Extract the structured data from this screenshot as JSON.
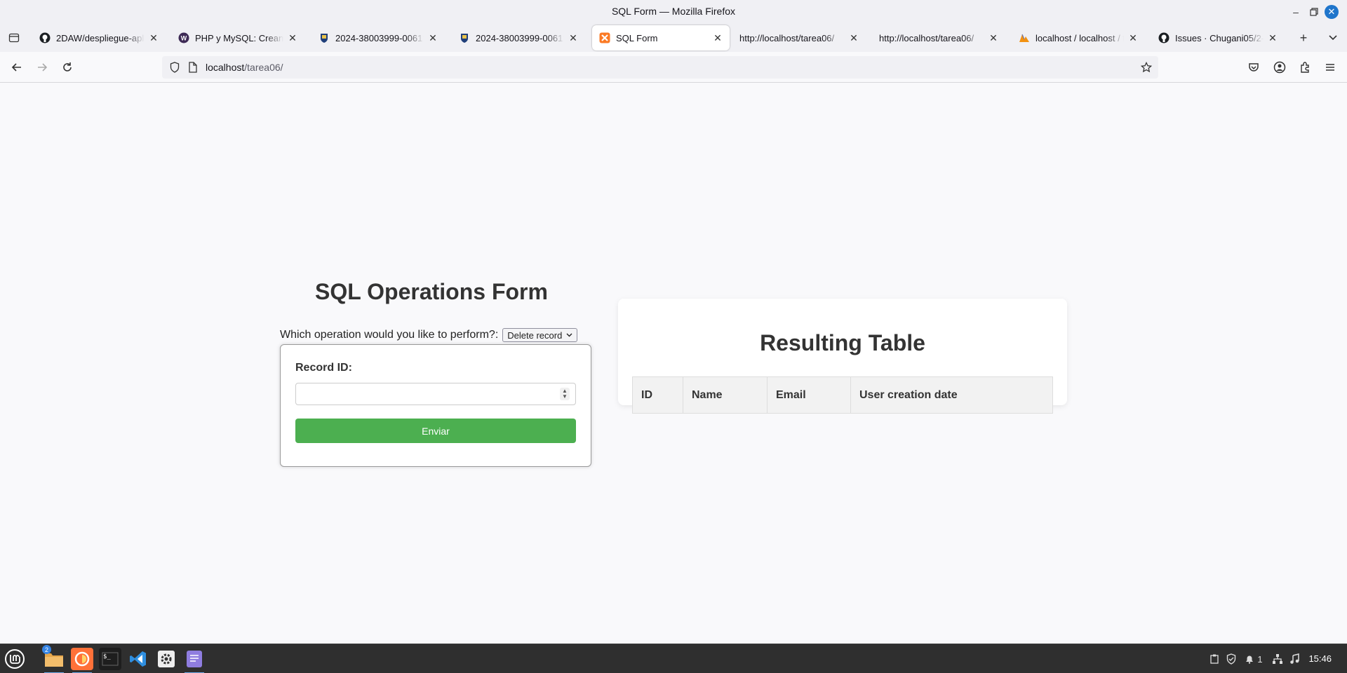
{
  "window": {
    "title": "SQL Form — Mozilla Firefox"
  },
  "tabs": [
    {
      "label": "2DAW/despliegue-aplic",
      "icon": "github-icon"
    },
    {
      "label": "PHP y MySQL: Creando",
      "icon": "wordpress-like-icon"
    },
    {
      "label": "2024-38003999-0061: T",
      "icon": "shield-crest-icon"
    },
    {
      "label": "2024-38003999-0061: Ir",
      "icon": "shield-crest-icon"
    },
    {
      "label": "SQL Form",
      "icon": "xampp-icon",
      "active": true
    },
    {
      "label": "http://localhost/tarea06/",
      "icon": ""
    },
    {
      "label": "http://localhost/tarea06/",
      "icon": ""
    },
    {
      "label": "localhost / localhost / ta",
      "icon": "phpmyadmin-icon"
    },
    {
      "label": "Issues · Chugani05/2-DA",
      "icon": "github-icon"
    }
  ],
  "urlbar": {
    "host": "localhost",
    "path": "/tarea06/"
  },
  "form": {
    "title": "SQL Operations Form",
    "operation_prompt": "Which operation would you like to perform?:",
    "operation_selected": "Delete record",
    "record_id_label": "Record ID:",
    "record_id_value": "",
    "submit_label": "Enviar"
  },
  "result": {
    "title": "Resulting Table",
    "columns": [
      "ID",
      "Name",
      "Email",
      "User creation date"
    ]
  },
  "taskbar": {
    "files_badge": "2",
    "notifications_count": "1",
    "clock": "15:46"
  },
  "colors": {
    "submit": "#4caf50",
    "window_close": "#1f75cb",
    "taskbar": "#2f2f2f"
  }
}
